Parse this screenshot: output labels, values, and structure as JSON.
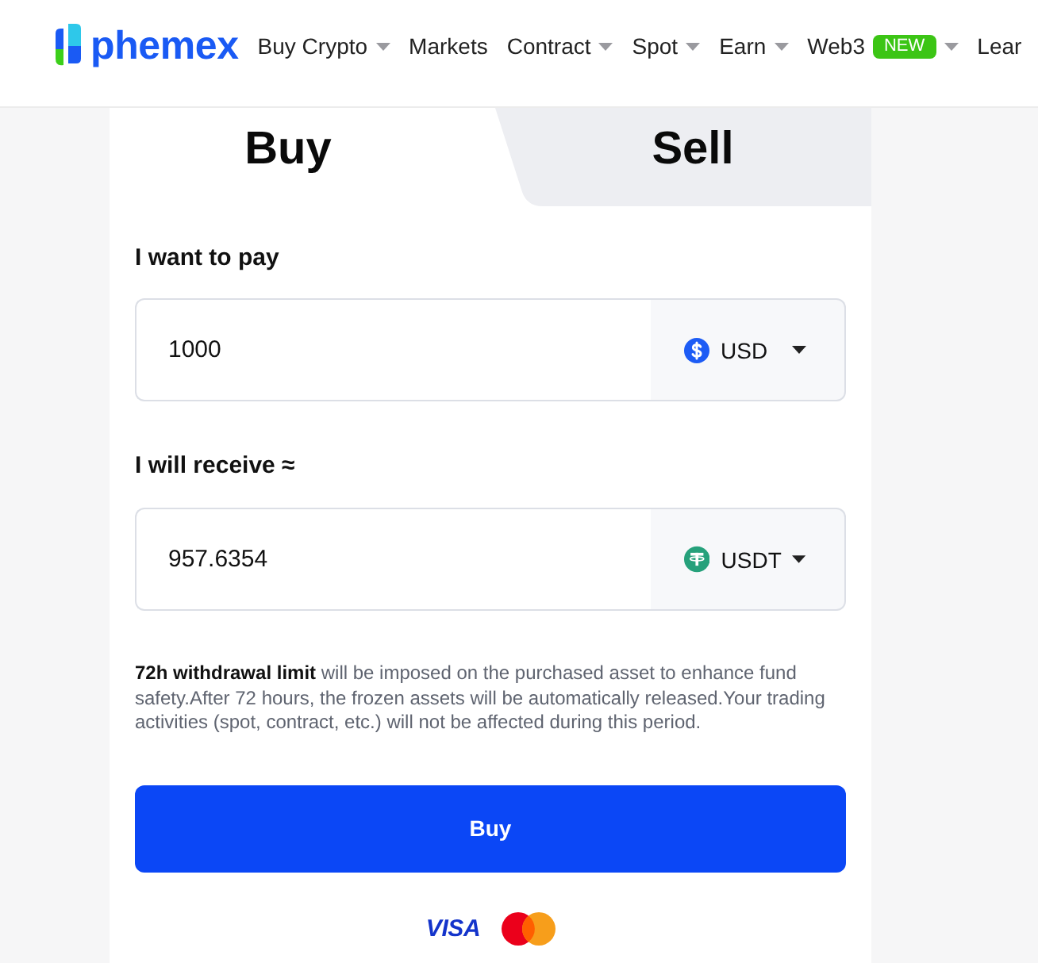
{
  "header": {
    "logo": "phemex",
    "nav": [
      {
        "label": "Buy Crypto",
        "dropdown": true
      },
      {
        "label": "Markets",
        "dropdown": false
      },
      {
        "label": "Contract",
        "dropdown": true
      },
      {
        "label": "Spot",
        "dropdown": true
      },
      {
        "label": "Earn",
        "dropdown": true
      },
      {
        "label": "Web3",
        "badge": "NEW",
        "dropdown": true
      },
      {
        "label": "Lear",
        "dropdown": false
      }
    ]
  },
  "tabs": [
    {
      "label": "Buy",
      "selected": true
    },
    {
      "label": "Sell",
      "selected": false
    }
  ],
  "pay": {
    "label": "I want to pay",
    "value": "1000",
    "currency": {
      "code": "USD",
      "kind": "usd"
    }
  },
  "receive": {
    "label": "I will receive ≈",
    "value": "957.6354",
    "currency": {
      "code": "USDT",
      "kind": "usdt"
    }
  },
  "notice": "**72h withdrawal limit** will be imposed on the purchased asset to enhance fund safety.After 72 hours, the frozen assets will be automatically released.Your trading activities (spot, contract, etc.) will not be affected during this period.",
  "submit": "Buy",
  "payment_methods": [
    {
      "kind": "visa",
      "label": "VISA"
    },
    {
      "kind": "mastercard"
    }
  ]
}
